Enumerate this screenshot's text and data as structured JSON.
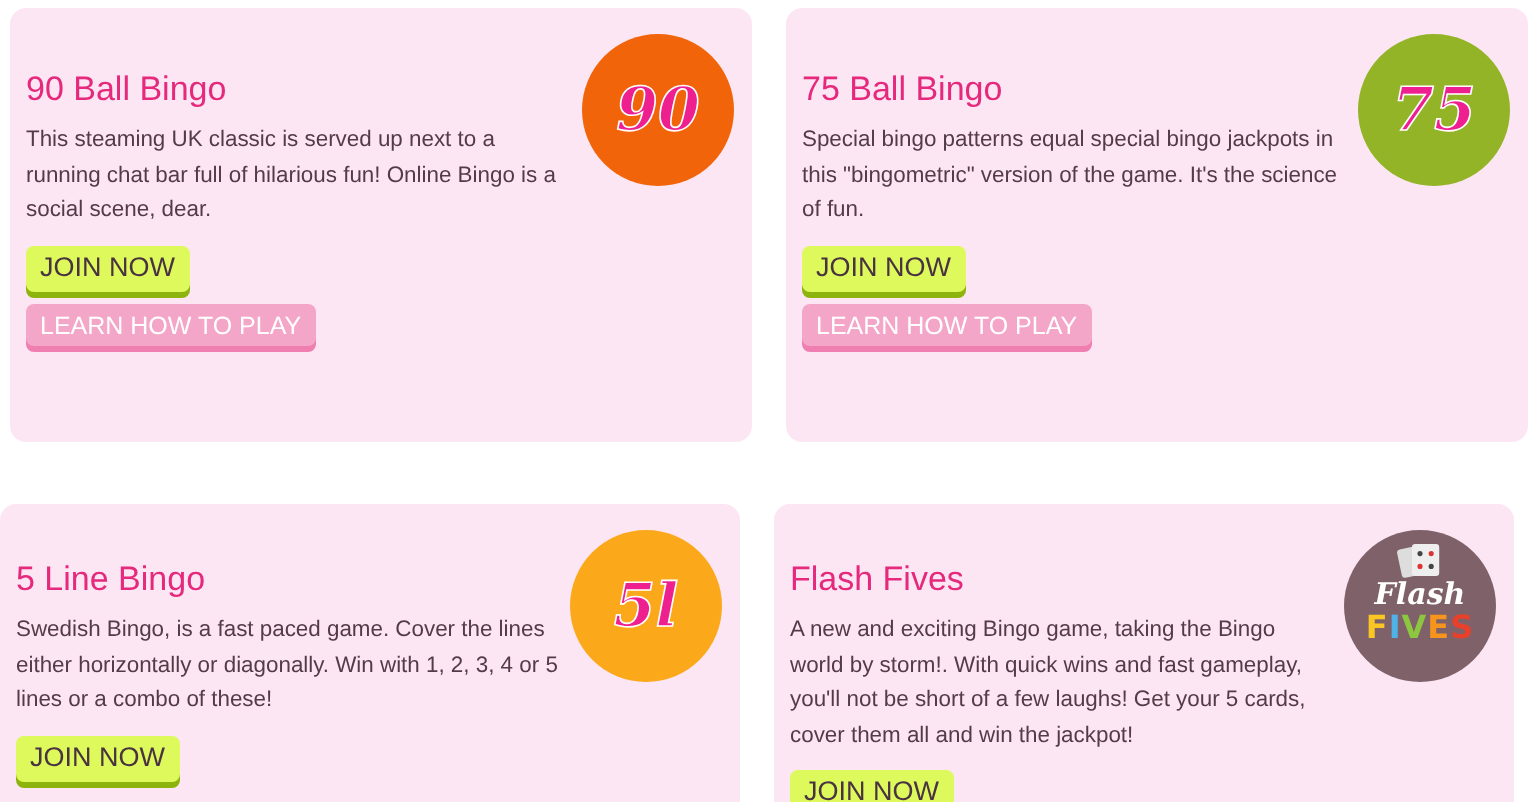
{
  "rows": [
    {
      "cards": [
        {
          "title": "90 Ball Bingo",
          "description": "This steaming UK classic is served up next to a running chat bar full of hilarious fun! Online Bingo is a social scene, dear.",
          "badge": {
            "kind": "number",
            "text": "90",
            "color": "#f2640a"
          },
          "buttons": [
            {
              "kind": "join",
              "label": "JOIN NOW"
            },
            {
              "kind": "learn",
              "label": "LEARN HOW TO PLAY"
            }
          ]
        },
        {
          "title": "75 Ball Bingo",
          "description": "Special bingo patterns equal special bingo jackpots in this \"bingometric\" version of the game. It's the science of fun.",
          "badge": {
            "kind": "number",
            "text": "75",
            "color": "#93b427"
          },
          "buttons": [
            {
              "kind": "join",
              "label": "JOIN NOW"
            },
            {
              "kind": "learn",
              "label": "LEARN HOW TO PLAY"
            }
          ]
        }
      ]
    },
    {
      "cards": [
        {
          "title": "5 Line Bingo",
          "description": "Swedish Bingo, is a fast paced game. Cover the lines either horizontally or diagonally. Win with 1, 2, 3, 4 or 5 lines or a combo of these!",
          "badge": {
            "kind": "number",
            "text": "5l",
            "color": "#fba91a"
          },
          "buttons": [
            {
              "kind": "join",
              "label": "JOIN NOW"
            }
          ]
        },
        {
          "title": "Flash Fives",
          "description": "A new and exciting Bingo game, taking the Bingo world by storm!. With quick wins and fast gameplay, you'll not be short of a few laughs! Get your 5 cards, cover them all and win the jackpot!",
          "badge": {
            "kind": "logo",
            "lines": [
              "Flash",
              "FIVES"
            ],
            "color": "#7f6269"
          },
          "buttons": [
            {
              "kind": "join",
              "label": "JOIN NOW"
            }
          ]
        }
      ]
    }
  ]
}
